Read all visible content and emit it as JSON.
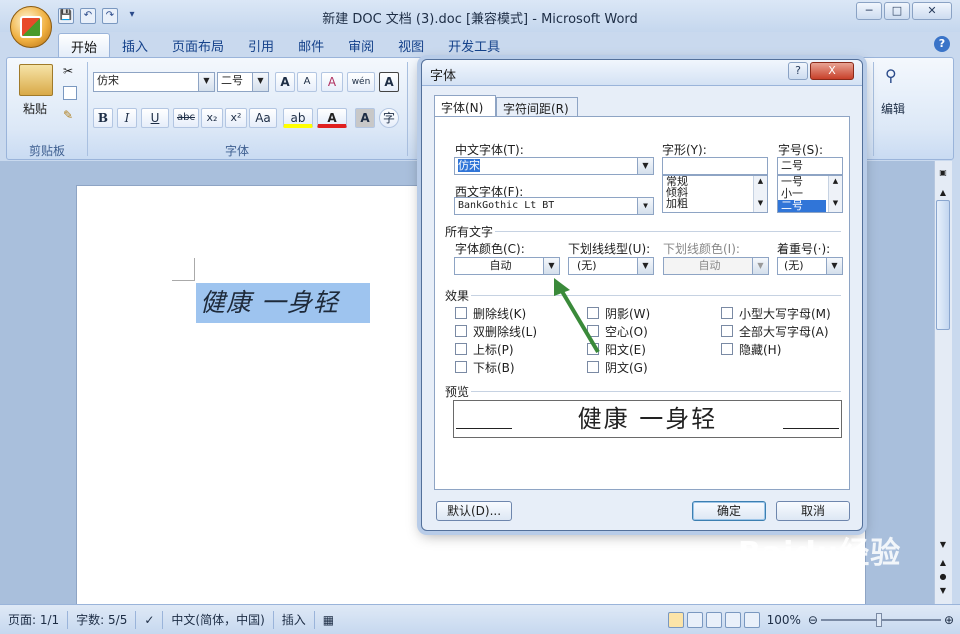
{
  "window": {
    "title": "新建 DOC 文档 (3).doc [兼容模式] - Microsoft Word",
    "minimize": "─",
    "restore": "□",
    "close": "✕"
  },
  "qat": {
    "save": "💾",
    "undo": "↶",
    "redo": "↷",
    "more": "▾"
  },
  "tabs": [
    "开始",
    "插入",
    "页面布局",
    "引用",
    "邮件",
    "审阅",
    "视图",
    "开发工具"
  ],
  "help": "?",
  "ribbon": {
    "clipboard": {
      "paste": "粘贴",
      "label": "剪贴板"
    },
    "font": {
      "family": "仿宋",
      "size": "二号",
      "grow": "A",
      "shrink": "A",
      "clear": "A",
      "bold": "B",
      "italic": "I",
      "underline": "U",
      "strike": "abc",
      "sub": "x₂",
      "sup": "x²",
      "case": "Aa",
      "label": "字体",
      "phonetic": "wén"
    },
    "editing": {
      "label": "编辑"
    }
  },
  "dialog": {
    "title": "字体",
    "help": "?",
    "close": "X",
    "tab_font": "字体(N)",
    "tab_spacing": "字符间距(R)",
    "cn_font_label": "中文字体(T):",
    "cn_font_value": "仿宋",
    "west_font_label": "西文字体(F):",
    "west_font_value": "BankGothic Lt BT",
    "style_label": "字形(Y):",
    "style_value": "",
    "style_options": [
      "常规",
      "倾斜",
      "加粗"
    ],
    "size_label": "字号(S):",
    "size_value": "二号",
    "size_options": [
      "一号",
      "小一",
      "二号"
    ],
    "all_text": "所有文字",
    "color_label": "字体颜色(C):",
    "color_value": "自动",
    "underline_label": "下划线线型(U):",
    "underline_value": "(无)",
    "ucolor_label": "下划线颜色(I):",
    "ucolor_value": "自动",
    "emph_label": "着重号(·):",
    "emph_value": "(无)",
    "effects": "效果",
    "effects_col1": [
      "删除线(K)",
      "双删除线(L)",
      "上标(P)",
      "下标(B)"
    ],
    "effects_col2": [
      "阴影(W)",
      "空心(O)",
      "阳文(E)",
      "阴文(G)"
    ],
    "effects_col3": [
      "小型大写字母(M)",
      "全部大写字母(A)",
      "隐藏(H)"
    ],
    "preview_label": "预览",
    "preview_text": "健康 一身轻",
    "default_btn": "默认(D)...",
    "ok_btn": "确定",
    "cancel_btn": "取消"
  },
  "document": {
    "text": "健康 一身轻"
  },
  "status": {
    "page": "页面: 1/1",
    "words": "字数: 5/5",
    "lang": "中文(简体，中国)",
    "mode": "插入",
    "zoom": "100%"
  },
  "watermark": "Baidu经验"
}
